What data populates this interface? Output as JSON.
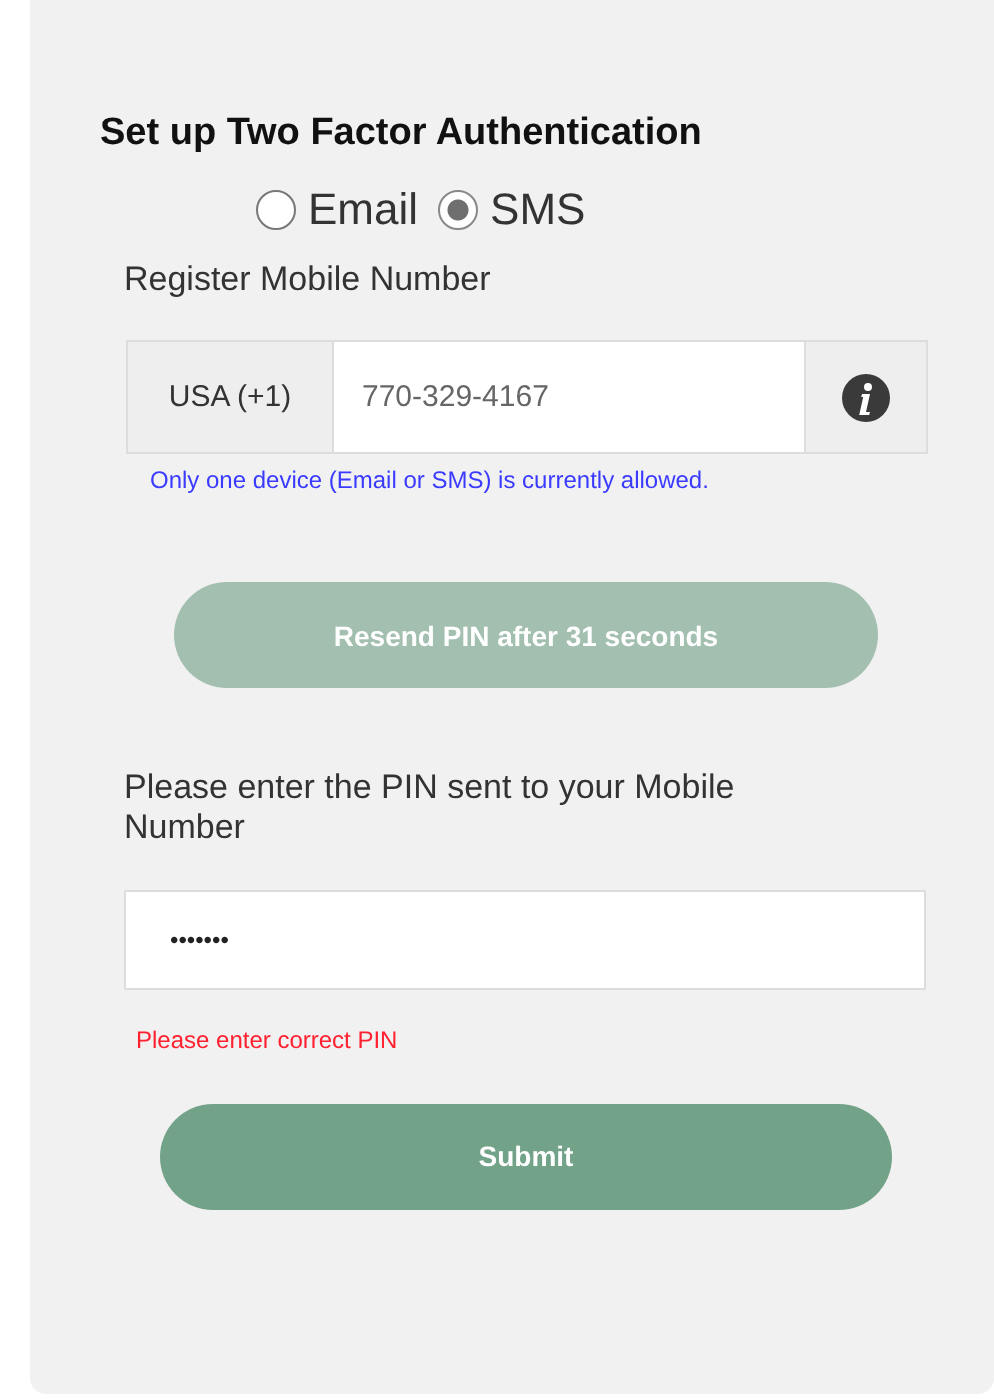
{
  "title": "Set up Two Factor Authentication",
  "methods": [
    {
      "label": "Email",
      "selected": false
    },
    {
      "label": "SMS",
      "selected": true
    }
  ],
  "mobile": {
    "label": "Register Mobile Number",
    "country_code": "USA (+1)",
    "value": "770-329-4167",
    "hint": "Only one device (Email or SMS) is currently allowed."
  },
  "resend_button": {
    "label": "Resend PIN after 31 seconds",
    "disabled": true
  },
  "pin": {
    "label": "Please enter the PIN sent to your Mobile Number",
    "value": "•••••••",
    "error": "Please enter correct PIN"
  },
  "submit_button": {
    "label": "Submit",
    "disabled": false
  }
}
